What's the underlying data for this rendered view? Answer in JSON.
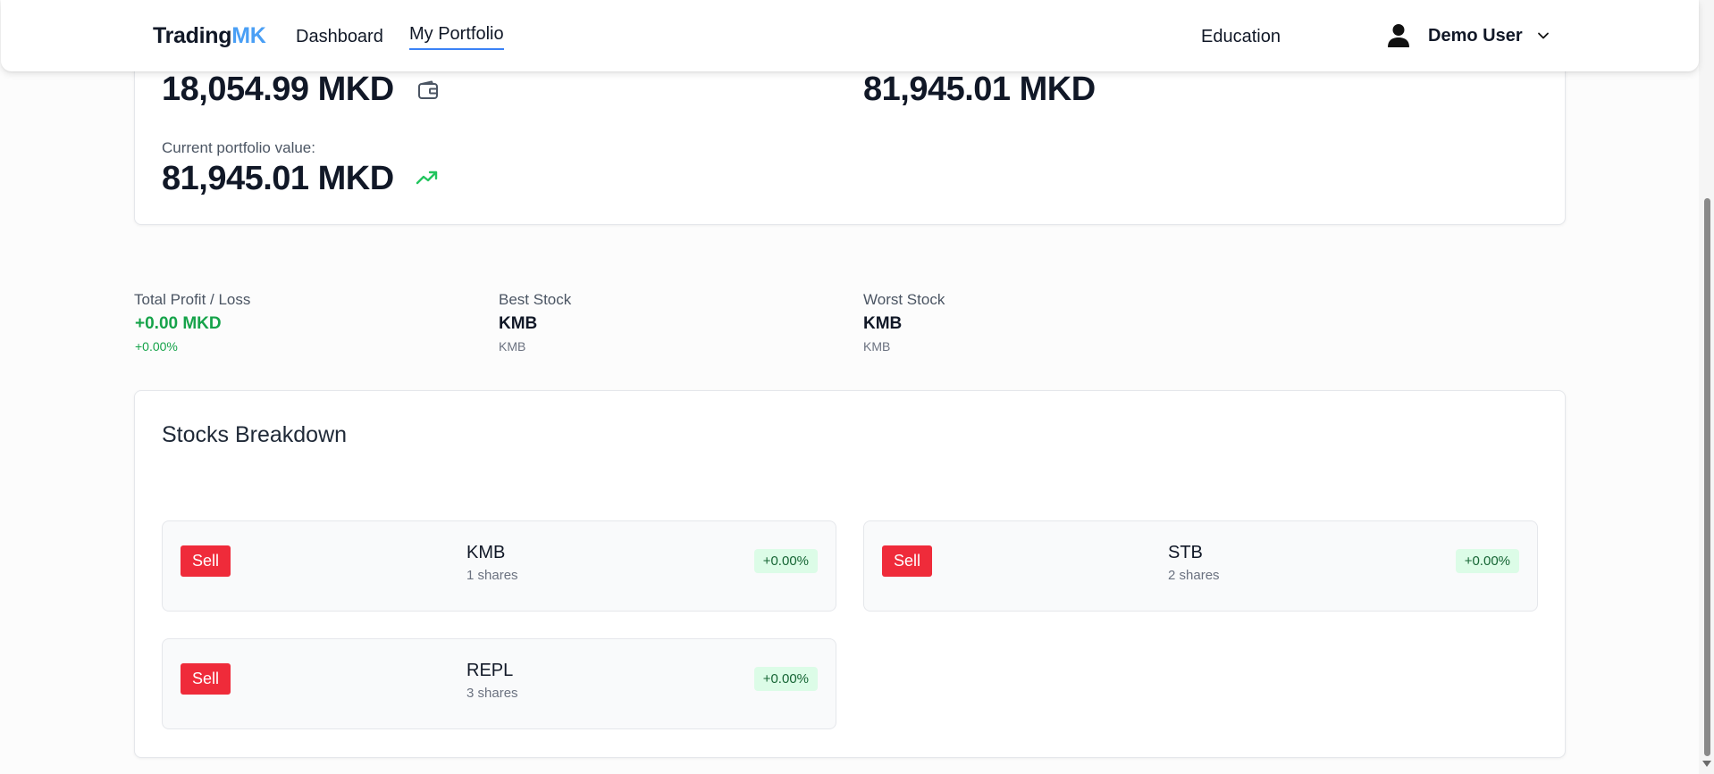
{
  "nav": {
    "brand_main": "Trading",
    "brand_accent": "MK",
    "links": {
      "dashboard": "Dashboard",
      "portfolio": "My Portfolio",
      "education": "Education"
    },
    "user_name": "Demo User"
  },
  "summary": {
    "available_value": "18,054.99 MKD",
    "invested_value": "81,945.01 MKD",
    "current_label": "Current portfolio value:",
    "current_value": "81,945.01 MKD"
  },
  "stats": {
    "total_label": "Total Profit / Loss",
    "total_value": "+0.00 MKD",
    "total_pct": "+0.00%",
    "best_label": "Best Stock",
    "best_value": "KMB",
    "best_sub": "KMB",
    "worst_label": "Worst Stock",
    "worst_value": "KMB",
    "worst_sub": "KMB"
  },
  "breakdown": {
    "title": "Stocks Breakdown",
    "sell_label": "Sell",
    "stocks": [
      {
        "ticker": "KMB",
        "shares": "1 shares",
        "change": "+0.00%"
      },
      {
        "ticker": "STB",
        "shares": "2 shares",
        "change": "+0.00%"
      },
      {
        "ticker": "REPL",
        "shares": "3 shares",
        "change": "+0.00%"
      }
    ]
  },
  "colors": {
    "accent": "#4a9ff5",
    "sell_red": "#ef2b3a",
    "positive_green": "#16a34a",
    "badge_bg": "#dcfce7"
  },
  "icons": {
    "wallet": "wallet-icon",
    "trend": "trending-up-icon",
    "user": "user-icon",
    "dropdown": "chevron-down-icon"
  }
}
